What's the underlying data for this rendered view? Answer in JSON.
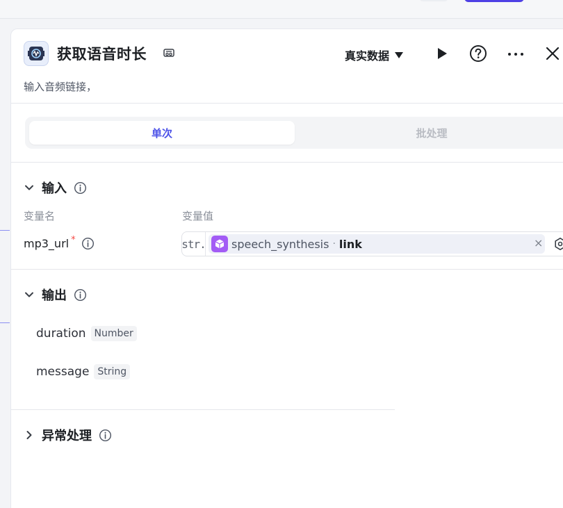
{
  "node": {
    "title": "获取语音时长",
    "description": "输入音频链接，",
    "data_mode_label": "真实数据"
  },
  "tabs": [
    {
      "label": "单次",
      "active": true
    },
    {
      "label": "批处理",
      "active": false
    }
  ],
  "input_section": {
    "title": "输入",
    "col_name_header": "变量名",
    "col_value_header": "变量值",
    "params": [
      {
        "name": "mp3_url",
        "required_mark": "*",
        "type_tag": "str.",
        "ref_node": "speech_synthesis",
        "ref_separator": "·",
        "ref_field": "link",
        "clear_glyph": "×"
      }
    ]
  },
  "output_section": {
    "title": "输出",
    "outputs": [
      {
        "name": "duration",
        "type": "Number"
      },
      {
        "name": "message",
        "type": "String"
      }
    ]
  },
  "exception_section": {
    "title": "异常处理"
  },
  "icons": {
    "node_logo": "speech-processor-icon",
    "edit": "edit-icon",
    "run": "play-icon",
    "help": "help-icon",
    "more": "more-icon",
    "close": "close-icon",
    "info": "info-icon",
    "ref_node": "cube-icon",
    "settings": "settings-icon"
  },
  "colors": {
    "accent": "#4d53e8",
    "primary_button": "#4e40e5",
    "ref_node_icon": "#a35cf5",
    "required": "#f54a45"
  }
}
